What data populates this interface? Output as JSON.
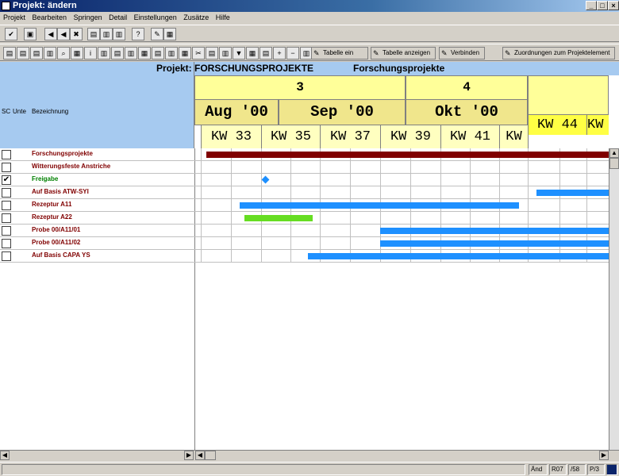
{
  "window": {
    "title": "Projekt: ändern"
  },
  "menu": [
    "Projekt",
    "Bearbeiten",
    "Springen",
    "Detail",
    "Einstellungen",
    "Zusätze",
    "Hilfe"
  ],
  "toolbar2": {
    "btn_table_on": "Tabelle ein",
    "btn_table_show": "Tabelle anzeigen",
    "btn_connect": "Verbinden",
    "btn_assign": "Zuordnungen zum Projektelement"
  },
  "header": {
    "project_label": "Projekt: FORSCHUNGSPROJEKTE",
    "project_desc": "Forschungsprojekte",
    "col_sc": "SC",
    "col_unte": "Unte",
    "col_bez": "Bezeichnung"
  },
  "timeline": {
    "quarters": [
      "3",
      "4"
    ],
    "months": [
      "Aug '00",
      "Sep '00",
      "Okt '00"
    ],
    "weeks": [
      "KW 33",
      "KW 35",
      "KW 37",
      "KW 39",
      "KW 41",
      "KW",
      "KW 44",
      "KW"
    ]
  },
  "rows": [
    {
      "label": "Forschungsprojekte",
      "checked": false
    },
    {
      "label": "Witterungsfeste Anstriche",
      "checked": false
    },
    {
      "label": "Freigabe",
      "checked": true
    },
    {
      "label": "Auf Basis ATW-SYI",
      "checked": false
    },
    {
      "label": "Rezeptur A11",
      "checked": false
    },
    {
      "label": "Rezeptur A22",
      "checked": false
    },
    {
      "label": "Probe 00/A11/01",
      "checked": false
    },
    {
      "label": "Probe 00/A11/02",
      "checked": false
    },
    {
      "label": "Auf Basis CAPA YS",
      "checked": false
    }
  ],
  "status": {
    "mode": "Änd",
    "row": "R07",
    "col": "/58",
    "page": "P/3"
  },
  "colors": {
    "summary": "#800000",
    "task": "#1e90ff",
    "critical": "#66dd22",
    "milestone": "#1e90ff"
  }
}
